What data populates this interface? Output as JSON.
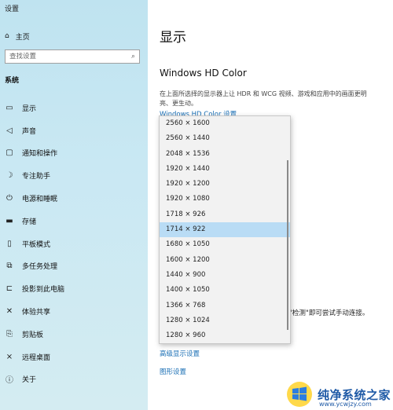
{
  "window": {
    "title": "设置"
  },
  "sidebar": {
    "home_label": "主页",
    "search_placeholder": "查找设置",
    "section_label": "系统",
    "items": [
      {
        "label": "显示",
        "icon": "monitor-icon"
      },
      {
        "label": "声音",
        "icon": "speaker-icon"
      },
      {
        "label": "通知和操作",
        "icon": "notification-icon"
      },
      {
        "label": "专注助手",
        "icon": "moon-icon"
      },
      {
        "label": "电源和睡眠",
        "icon": "power-icon"
      },
      {
        "label": "存储",
        "icon": "storage-icon"
      },
      {
        "label": "平板模式",
        "icon": "tablet-icon"
      },
      {
        "label": "多任务处理",
        "icon": "multitask-icon"
      },
      {
        "label": "投影到此电脑",
        "icon": "project-icon"
      },
      {
        "label": "体验共享",
        "icon": "share-icon"
      },
      {
        "label": "剪贴板",
        "icon": "clipboard-icon"
      },
      {
        "label": "远程桌面",
        "icon": "remote-desktop-icon"
      },
      {
        "label": "关于",
        "icon": "info-icon"
      }
    ]
  },
  "main": {
    "title": "显示",
    "hd_heading": "Windows HD Color",
    "hd_description": "在上面所选择的显示器上让 HDR 和 WCG 视频、游戏和应用中的画面更明亮、更生动。",
    "hd_settings_link": "Windows HD Color 设置",
    "partial_text": "\"检测\"即可尝试手动连接。",
    "advanced_link": "高级显示设置",
    "graphics_link": "图形设置"
  },
  "resolution_dropdown": {
    "options": [
      "2560 × 1600",
      "2560 × 1440",
      "2048 × 1536",
      "1920 × 1440",
      "1920 × 1200",
      "1920 × 1080",
      "1718 × 926",
      "1714 × 922",
      "1680 × 1050",
      "1600 × 1200",
      "1440 × 900",
      "1400 × 1050",
      "1366 × 768",
      "1280 × 1024",
      "1280 × 960"
    ],
    "selected": "1714 × 922"
  },
  "watermark": {
    "text": "纯净系统之家",
    "sub": "www.ycwjzy.com"
  },
  "colors": {
    "sidebar_bg": "#c9e8f3",
    "link": "#1a6fb5",
    "selected": "#b9dcf5"
  }
}
